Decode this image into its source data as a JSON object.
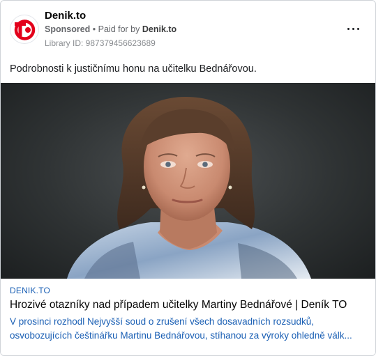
{
  "advertiser": {
    "name": "Denik.to",
    "sponsored_label": "Sponsored",
    "separator": " • ",
    "paid_for_prefix": "Paid for by ",
    "paid_for_name": "Denik.to",
    "library_id": "Library ID: 987379456623689",
    "logo_text": "TO"
  },
  "post": {
    "text": "Podrobnosti k justičnímu honu na učitelku Bednářovou."
  },
  "link": {
    "domain": "DENIK.TO",
    "title": "Hrozivé otazníky nad případem učitelky Martiny Bednářové | Deník TO",
    "description": "V prosinci rozhodl Nejvyšší soud o zrušení všech dosavadních rozsudků, osvobozujících češtinářku Martinu Bednářovou, stíhanou za výroky ohledně válk..."
  },
  "colors": {
    "brand_red": "#e3001b",
    "link_blue": "#1a5fb4",
    "secondary_text": "#65676b"
  },
  "icons": {
    "more": "more-options-icon"
  }
}
